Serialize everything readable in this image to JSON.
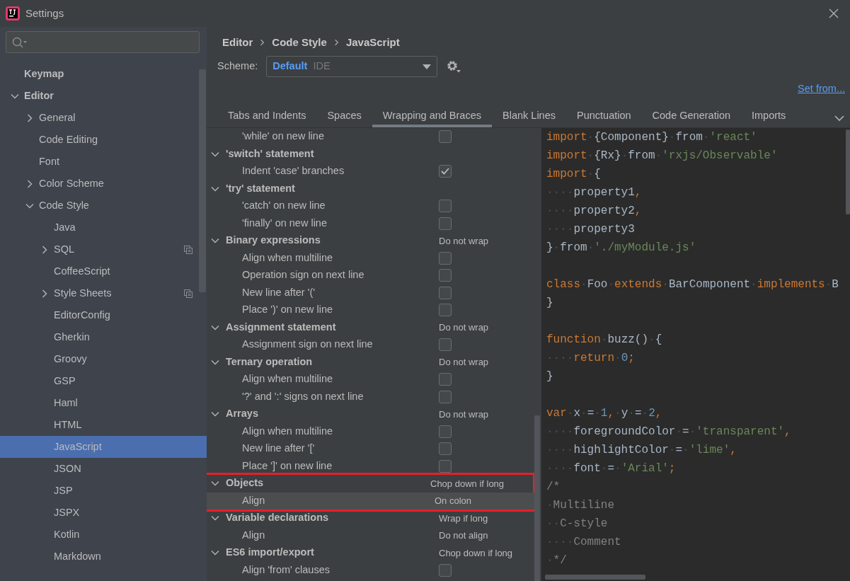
{
  "window": {
    "title": "Settings"
  },
  "sidebar": {
    "items": [
      {
        "label": "Keymap",
        "bold": true,
        "selected": false
      },
      {
        "label": "Editor",
        "bold": true,
        "expanded": true,
        "selected": false,
        "children": [
          {
            "label": "General",
            "expanded": false,
            "selected": false
          },
          {
            "label": "Code Editing",
            "selected": false
          },
          {
            "label": "Font",
            "selected": false
          },
          {
            "label": "Color Scheme",
            "expanded": false,
            "selected": false
          },
          {
            "label": "Code Style",
            "expanded": true,
            "selected": false,
            "children": [
              {
                "label": "Java",
                "selected": false,
                "scoped": false
              },
              {
                "label": "SQL",
                "expanded": false,
                "selected": false,
                "scoped": true
              },
              {
                "label": "CoffeeScript",
                "selected": false,
                "scoped": false
              },
              {
                "label": "Style Sheets",
                "expanded": false,
                "selected": false,
                "scoped": true
              },
              {
                "label": "EditorConfig",
                "selected": false,
                "scoped": false
              },
              {
                "label": "Gherkin",
                "selected": false,
                "scoped": false
              },
              {
                "label": "Groovy",
                "selected": false,
                "scoped": false
              },
              {
                "label": "GSP",
                "selected": false,
                "scoped": false
              },
              {
                "label": "Haml",
                "selected": false,
                "scoped": false
              },
              {
                "label": "HTML",
                "selected": false,
                "scoped": false
              },
              {
                "label": "JavaScript",
                "selected": true,
                "scoped": false
              },
              {
                "label": "JSON",
                "selected": false,
                "scoped": false
              },
              {
                "label": "JSP",
                "selected": false,
                "scoped": false
              },
              {
                "label": "JSPX",
                "selected": false,
                "scoped": false
              },
              {
                "label": "Kotlin",
                "selected": false,
                "scoped": false
              },
              {
                "label": "Markdown",
                "selected": false,
                "scoped": false
              }
            ]
          }
        ]
      }
    ]
  },
  "breadcrumb": [
    "Editor",
    "Code Style",
    "JavaScript"
  ],
  "scheme": {
    "label": "Scheme:",
    "name": "Default",
    "scope": "IDE"
  },
  "set_from": "Set from...",
  "tabs": [
    {
      "label": "Tabs and Indents",
      "selected": false
    },
    {
      "label": "Spaces",
      "selected": false
    },
    {
      "label": "Wrapping and Braces",
      "selected": true
    },
    {
      "label": "Blank Lines",
      "selected": false
    },
    {
      "label": "Punctuation",
      "selected": false
    },
    {
      "label": "Code Generation",
      "selected": false
    },
    {
      "label": "Imports",
      "selected": false
    }
  ],
  "options": [
    {
      "kind": "checkbox",
      "label": "'while' on new line",
      "checked": false,
      "selected": false
    },
    {
      "kind": "group",
      "label": "'switch' statement",
      "expanded": true,
      "outlined": false,
      "children": [
        {
          "kind": "checkbox",
          "label": "Indent 'case' branches",
          "checked": true,
          "selected": false
        }
      ]
    },
    {
      "kind": "group",
      "label": "'try' statement",
      "expanded": true,
      "outlined": false,
      "children": [
        {
          "kind": "checkbox",
          "label": "'catch' on new line",
          "checked": false,
          "selected": false
        },
        {
          "kind": "checkbox",
          "label": "'finally' on new line",
          "checked": false,
          "selected": false
        }
      ]
    },
    {
      "kind": "group",
      "label": "Binary expressions",
      "value": "Do not wrap",
      "expanded": true,
      "outlined": false,
      "children": [
        {
          "kind": "checkbox",
          "label": "Align when multiline",
          "checked": false,
          "selected": false
        },
        {
          "kind": "checkbox",
          "label": "Operation sign on next line",
          "checked": false,
          "selected": false
        },
        {
          "kind": "checkbox",
          "label": "New line after '('",
          "checked": false,
          "selected": false
        },
        {
          "kind": "checkbox",
          "label": "Place ')' on new line",
          "checked": false,
          "selected": false
        }
      ]
    },
    {
      "kind": "group",
      "label": "Assignment statement",
      "value": "Do not wrap",
      "expanded": true,
      "outlined": false,
      "children": [
        {
          "kind": "checkbox",
          "label": "Assignment sign on next line",
          "checked": false,
          "selected": false
        }
      ]
    },
    {
      "kind": "group",
      "label": "Ternary operation",
      "value": "Do not wrap",
      "expanded": true,
      "outlined": false,
      "children": [
        {
          "kind": "checkbox",
          "label": "Align when multiline",
          "checked": false,
          "selected": false
        },
        {
          "kind": "checkbox",
          "label": "'?' and ':' signs on next line",
          "checked": false,
          "selected": false
        }
      ]
    },
    {
      "kind": "group",
      "label": "Arrays",
      "value": "Do not wrap",
      "expanded": true,
      "outlined": false,
      "children": [
        {
          "kind": "checkbox",
          "label": "Align when multiline",
          "checked": false,
          "selected": false
        },
        {
          "kind": "checkbox",
          "label": "New line after '['",
          "checked": false,
          "selected": false
        },
        {
          "kind": "checkbox",
          "label": "Place ']' on new line",
          "checked": false,
          "selected": false
        }
      ]
    },
    {
      "kind": "group",
      "label": "Objects",
      "value": "Chop down if long",
      "expanded": true,
      "outlined": true,
      "children": [
        {
          "kind": "value",
          "label": "Align",
          "value": "On colon",
          "selected": true
        }
      ]
    },
    {
      "kind": "group",
      "label": "Variable declarations",
      "value": "Wrap if long",
      "expanded": true,
      "outlined": false,
      "children": [
        {
          "kind": "value",
          "label": "Align",
          "value": "Do not align",
          "selected": false
        }
      ]
    },
    {
      "kind": "group",
      "label": "ES6 import/export",
      "value": "Chop down if long",
      "expanded": true,
      "outlined": false,
      "children": [
        {
          "kind": "checkbox",
          "label": "Align 'from' clauses",
          "checked": false,
          "selected": false
        }
      ]
    }
  ],
  "code": [
    {
      "kind": "code",
      "tokens": [
        {
          "kind": "kw",
          "text": "import"
        },
        {
          "kind": "ws",
          "text": "·"
        },
        {
          "kind": "plain",
          "text": "{Component}"
        },
        {
          "kind": "ws",
          "text": "·"
        },
        {
          "kind": "plain",
          "text": "from"
        },
        {
          "kind": "ws",
          "text": "·"
        },
        {
          "kind": "str",
          "text": "'react'"
        }
      ]
    },
    {
      "kind": "code",
      "tokens": [
        {
          "kind": "kw",
          "text": "import"
        },
        {
          "kind": "ws",
          "text": "·"
        },
        {
          "kind": "plain",
          "text": "{Rx}"
        },
        {
          "kind": "ws",
          "text": "·"
        },
        {
          "kind": "plain",
          "text": "from"
        },
        {
          "kind": "ws",
          "text": "·"
        },
        {
          "kind": "str",
          "text": "'rxjs/Observable'"
        }
      ]
    },
    {
      "kind": "code",
      "tokens": [
        {
          "kind": "kw",
          "text": "import"
        },
        {
          "kind": "ws",
          "text": "·"
        },
        {
          "kind": "plain",
          "text": "{"
        }
      ]
    },
    {
      "kind": "code",
      "tokens": [
        {
          "kind": "ws",
          "text": "····"
        },
        {
          "kind": "plain",
          "text": "property1"
        },
        {
          "kind": "kw",
          "text": ","
        }
      ]
    },
    {
      "kind": "code",
      "tokens": [
        {
          "kind": "ws",
          "text": "····"
        },
        {
          "kind": "plain",
          "text": "property2"
        },
        {
          "kind": "kw",
          "text": ","
        }
      ]
    },
    {
      "kind": "code",
      "tokens": [
        {
          "kind": "ws",
          "text": "····"
        },
        {
          "kind": "plain",
          "text": "property3"
        }
      ]
    },
    {
      "kind": "code",
      "tokens": [
        {
          "kind": "plain",
          "text": "}"
        },
        {
          "kind": "ws",
          "text": "·"
        },
        {
          "kind": "plain",
          "text": "from"
        },
        {
          "kind": "ws",
          "text": "·"
        },
        {
          "kind": "str",
          "text": "'./myModule.js'"
        }
      ]
    },
    {
      "kind": "blank"
    },
    {
      "kind": "code",
      "tokens": [
        {
          "kind": "kw",
          "text": "class"
        },
        {
          "kind": "ws",
          "text": "·"
        },
        {
          "kind": "plain",
          "text": "Foo"
        },
        {
          "kind": "ws",
          "text": "·"
        },
        {
          "kind": "kw",
          "text": "extends"
        },
        {
          "kind": "ws",
          "text": "·"
        },
        {
          "kind": "plain",
          "text": "BarComponent"
        },
        {
          "kind": "ws",
          "text": "·"
        },
        {
          "kind": "kw",
          "text": "implements"
        },
        {
          "kind": "ws",
          "text": "·"
        },
        {
          "kind": "plain",
          "text": "B"
        }
      ]
    },
    {
      "kind": "code",
      "tokens": [
        {
          "kind": "plain",
          "text": "}"
        }
      ]
    },
    {
      "kind": "blank"
    },
    {
      "kind": "code",
      "tokens": [
        {
          "kind": "kw",
          "text": "function"
        },
        {
          "kind": "ws",
          "text": "·"
        },
        {
          "kind": "plain",
          "text": "buzz()"
        },
        {
          "kind": "ws",
          "text": "·"
        },
        {
          "kind": "plain",
          "text": "{"
        }
      ]
    },
    {
      "kind": "code",
      "tokens": [
        {
          "kind": "ws",
          "text": "····"
        },
        {
          "kind": "kw",
          "text": "return"
        },
        {
          "kind": "ws",
          "text": "·"
        },
        {
          "kind": "num",
          "text": "0"
        },
        {
          "kind": "kw",
          "text": ";"
        }
      ]
    },
    {
      "kind": "code",
      "tokens": [
        {
          "kind": "plain",
          "text": "}"
        }
      ]
    },
    {
      "kind": "blank"
    },
    {
      "kind": "code",
      "tokens": [
        {
          "kind": "kw",
          "text": "var"
        },
        {
          "kind": "ws",
          "text": "·"
        },
        {
          "kind": "plain",
          "text": "x"
        },
        {
          "kind": "ws",
          "text": "·"
        },
        {
          "kind": "plain",
          "text": "="
        },
        {
          "kind": "ws",
          "text": "·"
        },
        {
          "kind": "num",
          "text": "1"
        },
        {
          "kind": "kw",
          "text": ","
        },
        {
          "kind": "ws",
          "text": "·"
        },
        {
          "kind": "plain",
          "text": "y"
        },
        {
          "kind": "ws",
          "text": "·"
        },
        {
          "kind": "plain",
          "text": "="
        },
        {
          "kind": "ws",
          "text": "·"
        },
        {
          "kind": "num",
          "text": "2"
        },
        {
          "kind": "kw",
          "text": ","
        }
      ]
    },
    {
      "kind": "code",
      "tokens": [
        {
          "kind": "ws",
          "text": "····"
        },
        {
          "kind": "plain",
          "text": "foregroundColor"
        },
        {
          "kind": "ws",
          "text": "·"
        },
        {
          "kind": "plain",
          "text": "="
        },
        {
          "kind": "ws",
          "text": "·"
        },
        {
          "kind": "str",
          "text": "'transparent'"
        },
        {
          "kind": "kw",
          "text": ","
        }
      ]
    },
    {
      "kind": "code",
      "tokens": [
        {
          "kind": "ws",
          "text": "····"
        },
        {
          "kind": "plain",
          "text": "highlightColor"
        },
        {
          "kind": "ws",
          "text": "·"
        },
        {
          "kind": "plain",
          "text": "="
        },
        {
          "kind": "ws",
          "text": "·"
        },
        {
          "kind": "str",
          "text": "'lime'"
        },
        {
          "kind": "kw",
          "text": ","
        }
      ]
    },
    {
      "kind": "code",
      "tokens": [
        {
          "kind": "ws",
          "text": "····"
        },
        {
          "kind": "plain",
          "text": "font"
        },
        {
          "kind": "ws",
          "text": "·"
        },
        {
          "kind": "plain",
          "text": "="
        },
        {
          "kind": "ws",
          "text": "·"
        },
        {
          "kind": "str",
          "text": "'Arial'"
        },
        {
          "kind": "kw",
          "text": ";"
        }
      ]
    },
    {
      "kind": "code",
      "tokens": [
        {
          "kind": "comment",
          "text": "/*"
        }
      ]
    },
    {
      "kind": "code",
      "tokens": [
        {
          "kind": "ws",
          "text": "·"
        },
        {
          "kind": "comment",
          "text": "Multiline"
        }
      ]
    },
    {
      "kind": "code",
      "tokens": [
        {
          "kind": "ws",
          "text": "··"
        },
        {
          "kind": "comment",
          "text": "C-style"
        }
      ]
    },
    {
      "kind": "code",
      "tokens": [
        {
          "kind": "ws",
          "text": "····"
        },
        {
          "kind": "comment",
          "text": "Comment"
        }
      ]
    },
    {
      "kind": "code",
      "tokens": [
        {
          "kind": "ws",
          "text": "·"
        },
        {
          "kind": "comment",
          "text": "*/"
        }
      ]
    }
  ]
}
